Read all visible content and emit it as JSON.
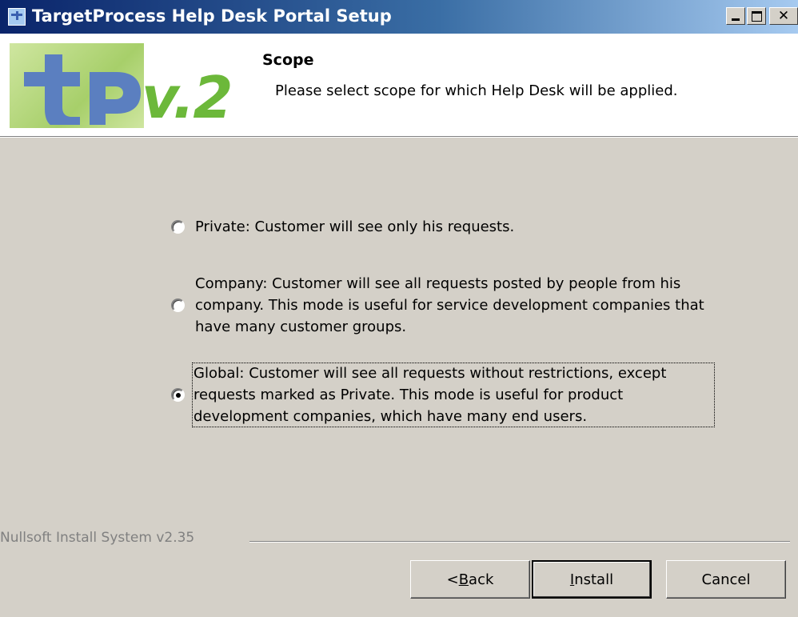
{
  "window": {
    "title": "TargetProcess Help Desk Portal Setup",
    "controls": [
      "minimize-icon",
      "maximize-icon",
      "close-icon"
    ]
  },
  "header": {
    "logo_version": "v.2",
    "title": "Scope",
    "subtitle": "Please select scope for which Help Desk will be applied."
  },
  "options": [
    {
      "label": "Private: Customer will see only his requests.",
      "checked": false
    },
    {
      "label": "Company: Customer will see all requests posted by people from his company. This mode is useful for service development companies that have many customer groups.",
      "checked": false
    },
    {
      "label": "Global: Customer will see all requests without restrictions, except requests marked as Private. This mode is useful for product development companies, which have many end users.",
      "checked": true
    }
  ],
  "footer": {
    "branding": "Nullsoft Install System v2.35",
    "buttons": {
      "back_prefix": "< ",
      "back_mnemonic": "B",
      "back_rest": "ack",
      "install_mnemonic": "I",
      "install_rest": "nstall",
      "cancel": "Cancel"
    }
  },
  "colors": {
    "title_bar_start": "#0a246a",
    "title_bar_end": "#a6caf0",
    "dialog_bg": "#d4d0c8",
    "logo_green": "#6cb83a",
    "logo_blue": "#5b7fc0"
  }
}
